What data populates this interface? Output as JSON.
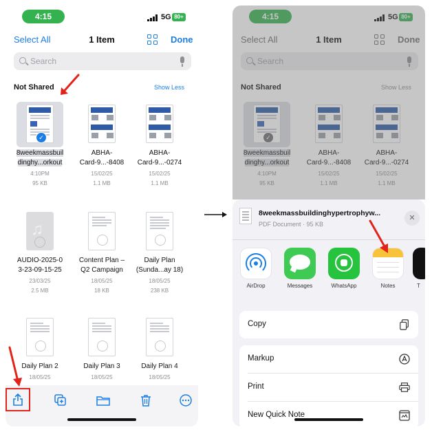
{
  "status": {
    "time": "4:15",
    "network": "5G",
    "battery": "80+"
  },
  "left": {
    "nav": {
      "select_all": "Select All",
      "title": "1 Item",
      "done": "Done"
    },
    "search": {
      "placeholder": "Search"
    },
    "section": {
      "title": "Not Shared",
      "action": "Show Less"
    },
    "files": [
      {
        "name1": "8weekmassbuil",
        "name2": "dinghy...orkout",
        "date": "4:10PM",
        "size": "95 KB",
        "kind": "pdf",
        "selected": true
      },
      {
        "name1": "ABHA-",
        "name2": "Card-9...-8408",
        "date": "15/02/25",
        "size": "1.1 MB",
        "kind": "pdf"
      },
      {
        "name1": "ABHA-",
        "name2": "Card-9...-0274",
        "date": "15/02/25",
        "size": "1.1 MB",
        "kind": "pdf"
      },
      {
        "name1": "AUDIO-2025-0",
        "name2": "3-23-09-15-25",
        "date": "23/03/25",
        "size": "2.5 MB",
        "kind": "audio"
      },
      {
        "name1": "Content Plan –",
        "name2": "Q2 Campaign",
        "date": "18/05/25",
        "size": "18 KB",
        "kind": "doc"
      },
      {
        "name1": "Daily Plan",
        "name2": "(Sunda...ay 18)",
        "date": "18/05/25",
        "size": "238 KB",
        "kind": "doc"
      },
      {
        "name1": "Daily Plan 2",
        "name2": "",
        "date": "18/05/25",
        "size": "",
        "kind": "doc"
      },
      {
        "name1": "Daily Plan 3",
        "name2": "",
        "date": "18/05/25",
        "size": "",
        "kind": "doc"
      },
      {
        "name1": "Daily Plan 4",
        "name2": "",
        "date": "18/05/25",
        "size": "",
        "kind": "doc"
      }
    ],
    "toolbar": [
      {
        "name": "share-icon",
        "glyph": "⇪"
      },
      {
        "name": "duplicate-icon",
        "glyph": "⧉"
      },
      {
        "name": "folder-icon",
        "glyph": "▭"
      },
      {
        "name": "trash-icon",
        "glyph": "␡"
      },
      {
        "name": "more-icon",
        "glyph": "⋯"
      }
    ]
  },
  "right": {
    "sheet": {
      "title": "8weekmassbuildinghypertrophyw...",
      "subtitle": "PDF Document · 95 KB",
      "close": "✕"
    },
    "apps": [
      {
        "label": "AirDrop"
      },
      {
        "label": "Messages"
      },
      {
        "label": "WhatsApp"
      },
      {
        "label": "Notes"
      },
      {
        "label": "T"
      }
    ],
    "actions": {
      "copy": "Copy",
      "markup": "Markup",
      "print": "Print",
      "quick_note": "New Quick Note"
    }
  },
  "colors": {
    "accent": "#1a7ee6",
    "highlight": "#e2231a",
    "status_green": "#34b24f"
  }
}
